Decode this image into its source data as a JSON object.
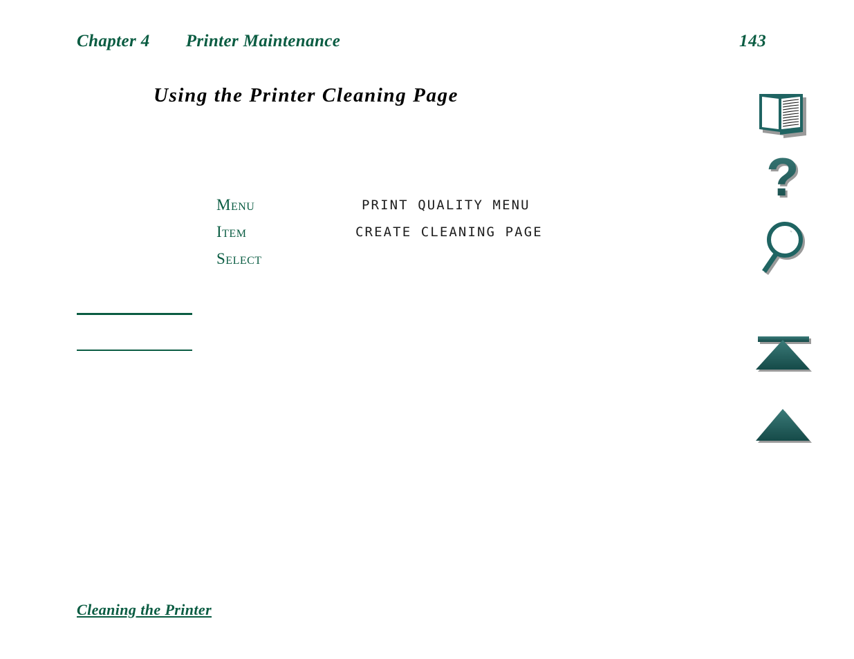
{
  "document": {
    "header": {
      "chapter_label": "Chapter 4",
      "chapter_title": "Printer Maintenance",
      "page_number": "143"
    },
    "section_title": "Using the Printer Cleaning Page",
    "control_panel": {
      "rows": [
        {
          "key": "Menu",
          "value": "PRINT QUALITY MENU"
        },
        {
          "key": "Item",
          "value": "CREATE CLEANING PAGE"
        },
        {
          "key": "Select",
          "value": ""
        }
      ]
    },
    "footer": {
      "link": "Cleaning the Printer"
    },
    "nav_icons": [
      {
        "name": "book-icon",
        "title": "Table of Contents"
      },
      {
        "name": "help-icon",
        "title": "Help"
      },
      {
        "name": "search-icon",
        "title": "Search"
      },
      {
        "name": "top-of-page-icon",
        "title": "Top of Page"
      },
      {
        "name": "previous-page-icon",
        "title": "Previous Page"
      }
    ],
    "colors": {
      "green": "#0a5c42",
      "teal": "#2b6b6b",
      "teal_dark": "#154a4a",
      "text": "#000000",
      "lcd_text": "#1d1d1d",
      "shadow": "#9a9a9a"
    }
  }
}
